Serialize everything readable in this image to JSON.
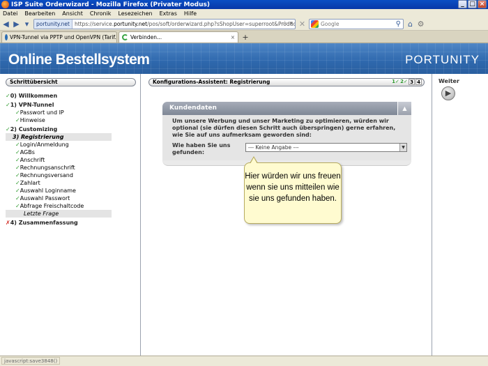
{
  "window": {
    "title": "ISP Suite Orderwizard - Mozilla Firefox (Privater Modus)",
    "buttons": [
      "_",
      "□",
      "×"
    ]
  },
  "menu": [
    "Datei",
    "Bearbeiten",
    "Ansicht",
    "Chronik",
    "Lesezeichen",
    "Extras",
    "Hilfe"
  ],
  "nav": {
    "site_badge": "portunity.net",
    "url_prefix": "https://service.",
    "url_domain": "portunity.net",
    "url_suffix": "/pos/soft/orderwizard.php?sShopUser=superroot&Productgroup=96",
    "search_placeholder": "Google"
  },
  "tabs": [
    {
      "label": "VPN-Tunnel via PPTP und OpenVPN (Tarif..."
    },
    {
      "label": "Verbinden..."
    }
  ],
  "banner": {
    "title": "Online Bestellsystem",
    "logo": "PORTUNITY"
  },
  "sidebar": {
    "header": "Schrittübersicht",
    "steps": [
      {
        "mark": "✓",
        "label": "0) Willkommen",
        "level": 0,
        "state": "done"
      },
      {
        "mark": "✓",
        "label": "1) VPN-Tunnel",
        "level": 0,
        "state": "done"
      },
      {
        "mark": "✓",
        "label": "Passwort und IP",
        "level": 1,
        "state": "done"
      },
      {
        "mark": "✓",
        "label": "Hinweise",
        "level": 1,
        "state": "done"
      },
      {
        "mark": "✓",
        "label": "2) Customizing",
        "level": 0,
        "state": "done"
      },
      {
        "mark": "",
        "label": "3) Registrierung",
        "level": 0,
        "state": "current"
      },
      {
        "mark": "✓",
        "label": "Login/Anmeldung",
        "level": 1,
        "state": "done"
      },
      {
        "mark": "✓",
        "label": "AGBs",
        "level": 1,
        "state": "done"
      },
      {
        "mark": "✓",
        "label": "Anschrift",
        "level": 1,
        "state": "done"
      },
      {
        "mark": "✓",
        "label": "Rechnungsanschrift",
        "level": 1,
        "state": "done"
      },
      {
        "mark": "✓",
        "label": "Rechnungsversand",
        "level": 1,
        "state": "done"
      },
      {
        "mark": "✓",
        "label": "Zahlart",
        "level": 1,
        "state": "done"
      },
      {
        "mark": "✓",
        "label": "Auswahl Loginname",
        "level": 1,
        "state": "done"
      },
      {
        "mark": "✓",
        "label": "Auswahl Passwort",
        "level": 1,
        "state": "done"
      },
      {
        "mark": "✓",
        "label": "Abfrage Freischaltcode",
        "level": 1,
        "state": "done"
      },
      {
        "mark": "",
        "label": "Letzte Frage",
        "level": 1,
        "state": "pending"
      },
      {
        "mark": "✗",
        "label": "4) Zusammenfassung",
        "level": 0,
        "state": "error"
      }
    ]
  },
  "wizard": {
    "header": "Konfigurations-Assistent: Registrierung",
    "steps": [
      "1✓",
      "2✓",
      "3",
      "4"
    ]
  },
  "kundendaten": {
    "title": "Kundendaten",
    "toggle": "▲",
    "text": "Um unsere Werbung und unser Marketing zu optimieren, würden wir optional (sie dürfen diesen Schritt auch überspringen) gerne erfahren, wie Sie auf uns aufmerksam geworden sind:",
    "field_label": "Wie haben Sie uns gefunden:",
    "select_value": "--- Keine Angabe ---"
  },
  "tooltip": {
    "text": "Hier würden wir uns freuen wenn sie uns mitteilen wie sie uns gefunden haben."
  },
  "right": {
    "weiter_label": "Weiter",
    "weiter_icon": "▶"
  },
  "status": {
    "text": "javascript:save3848()"
  }
}
